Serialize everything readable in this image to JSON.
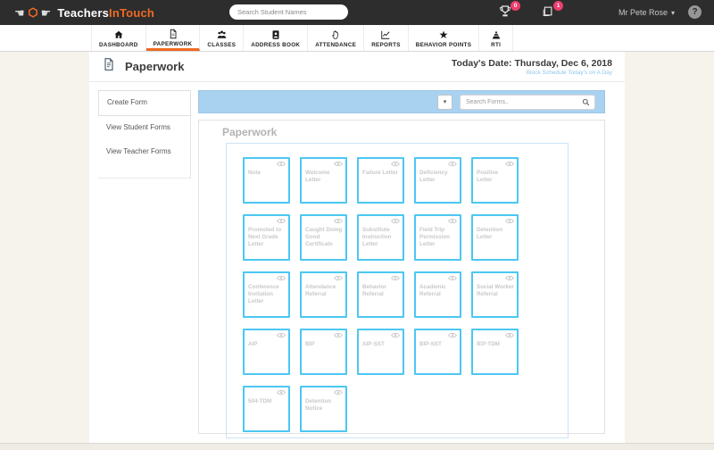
{
  "header": {
    "brand": {
      "primary": "Teachers",
      "secondary": "InTouch"
    },
    "search_placeholder": "Search Student Names",
    "trophy_badge": "0",
    "forms_badge": "1",
    "user_name": "Mr Pete Rose",
    "help_label": "?"
  },
  "nav": {
    "items": [
      {
        "label": "DASHBOARD",
        "icon": "home-icon",
        "active": false
      },
      {
        "label": "PAPERWORK",
        "icon": "document-icon",
        "active": true
      },
      {
        "label": "CLASSES",
        "icon": "people-icon",
        "active": false
      },
      {
        "label": "ADDRESS BOOK",
        "icon": "address-book-icon",
        "active": false
      },
      {
        "label": "ATTENDANCE",
        "icon": "hand-icon",
        "active": false
      },
      {
        "label": "REPORTS",
        "icon": "chart-icon",
        "active": false
      },
      {
        "label": "BEHAVIOR POINTS",
        "icon": "star-icon",
        "active": false
      },
      {
        "label": "RTI",
        "icon": "pyramid-icon",
        "active": false
      }
    ]
  },
  "page": {
    "title": "Paperwork",
    "date_label": "Today's Date: Thursday, Dec 6, 2018",
    "schedule_note": "Block Schedule Today's on A Day"
  },
  "sidebar": {
    "items": [
      {
        "label": "Create Form",
        "active": true
      },
      {
        "label": "View Student Forms",
        "active": false
      },
      {
        "label": "View Teacher Forms",
        "active": false
      }
    ]
  },
  "toolbar": {
    "search_placeholder": "Search Forms..",
    "dropdown_caret": "▾"
  },
  "forms_section": {
    "heading": "Paperwork",
    "cards": [
      "Note",
      "Welcome Letter",
      "Failure Letter",
      "Deficiency Letter",
      "Positive Letter",
      "Promoted to Next Grade Letter",
      "Caught Doing Good Certificate",
      "Substitute Instruction Letter",
      "Field Trip Permission Letter",
      "Detention Letter",
      "Conference Invitation Letter",
      "Attendance Referral",
      "Behavior Referral",
      "Academic Referral",
      "Social Worker Referral",
      "AIP",
      "BIP",
      "AIP-SST",
      "BIP-SST",
      "IEP-TDM",
      "504-TDM",
      "Detention Notice"
    ]
  },
  "colors": {
    "accent_orange": "#f06a24",
    "badge_pink": "#ee3d6e",
    "topbar_dark": "#2d2d2d",
    "toolbar_blue": "#a9d2f0",
    "card_border_cyan": "#4cc7f2",
    "grid_box_border": "#cde4f6",
    "schedule_link_blue": "#8ec7ee",
    "page_background": "#f6f3ec"
  }
}
